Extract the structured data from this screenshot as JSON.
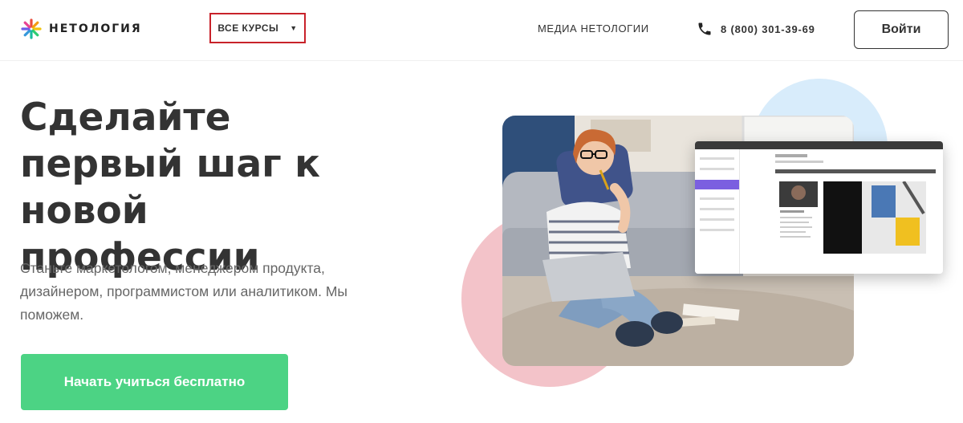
{
  "header": {
    "logo_text": "НЕТОЛОГИЯ",
    "courses_label": "ВСЕ КУРСЫ",
    "courses_caret": "▼",
    "media_label": "МЕДИА НЕТОЛОГИИ",
    "phone": "8 (800) 301-39-69",
    "login_label": "Войти"
  },
  "hero": {
    "headline": "Сделайте первый шаг к новой профессии",
    "subtitle": "Станьте маркетологом, менеджером продукта, дизайнером, программистом или аналитиком. Мы поможем.",
    "cta_label": "Начать учиться бесплатно"
  },
  "colors": {
    "cta": "#4cd384",
    "highlight_border": "#c8222a",
    "circle_blue": "#d8ecfb",
    "circle_pink": "#f3c3c9",
    "mockup_accent": "#7b5fe0"
  },
  "icons": {
    "logo": "netology-asterisk-logo",
    "phone": "phone-icon",
    "dropdown": "triangle-down-icon"
  }
}
